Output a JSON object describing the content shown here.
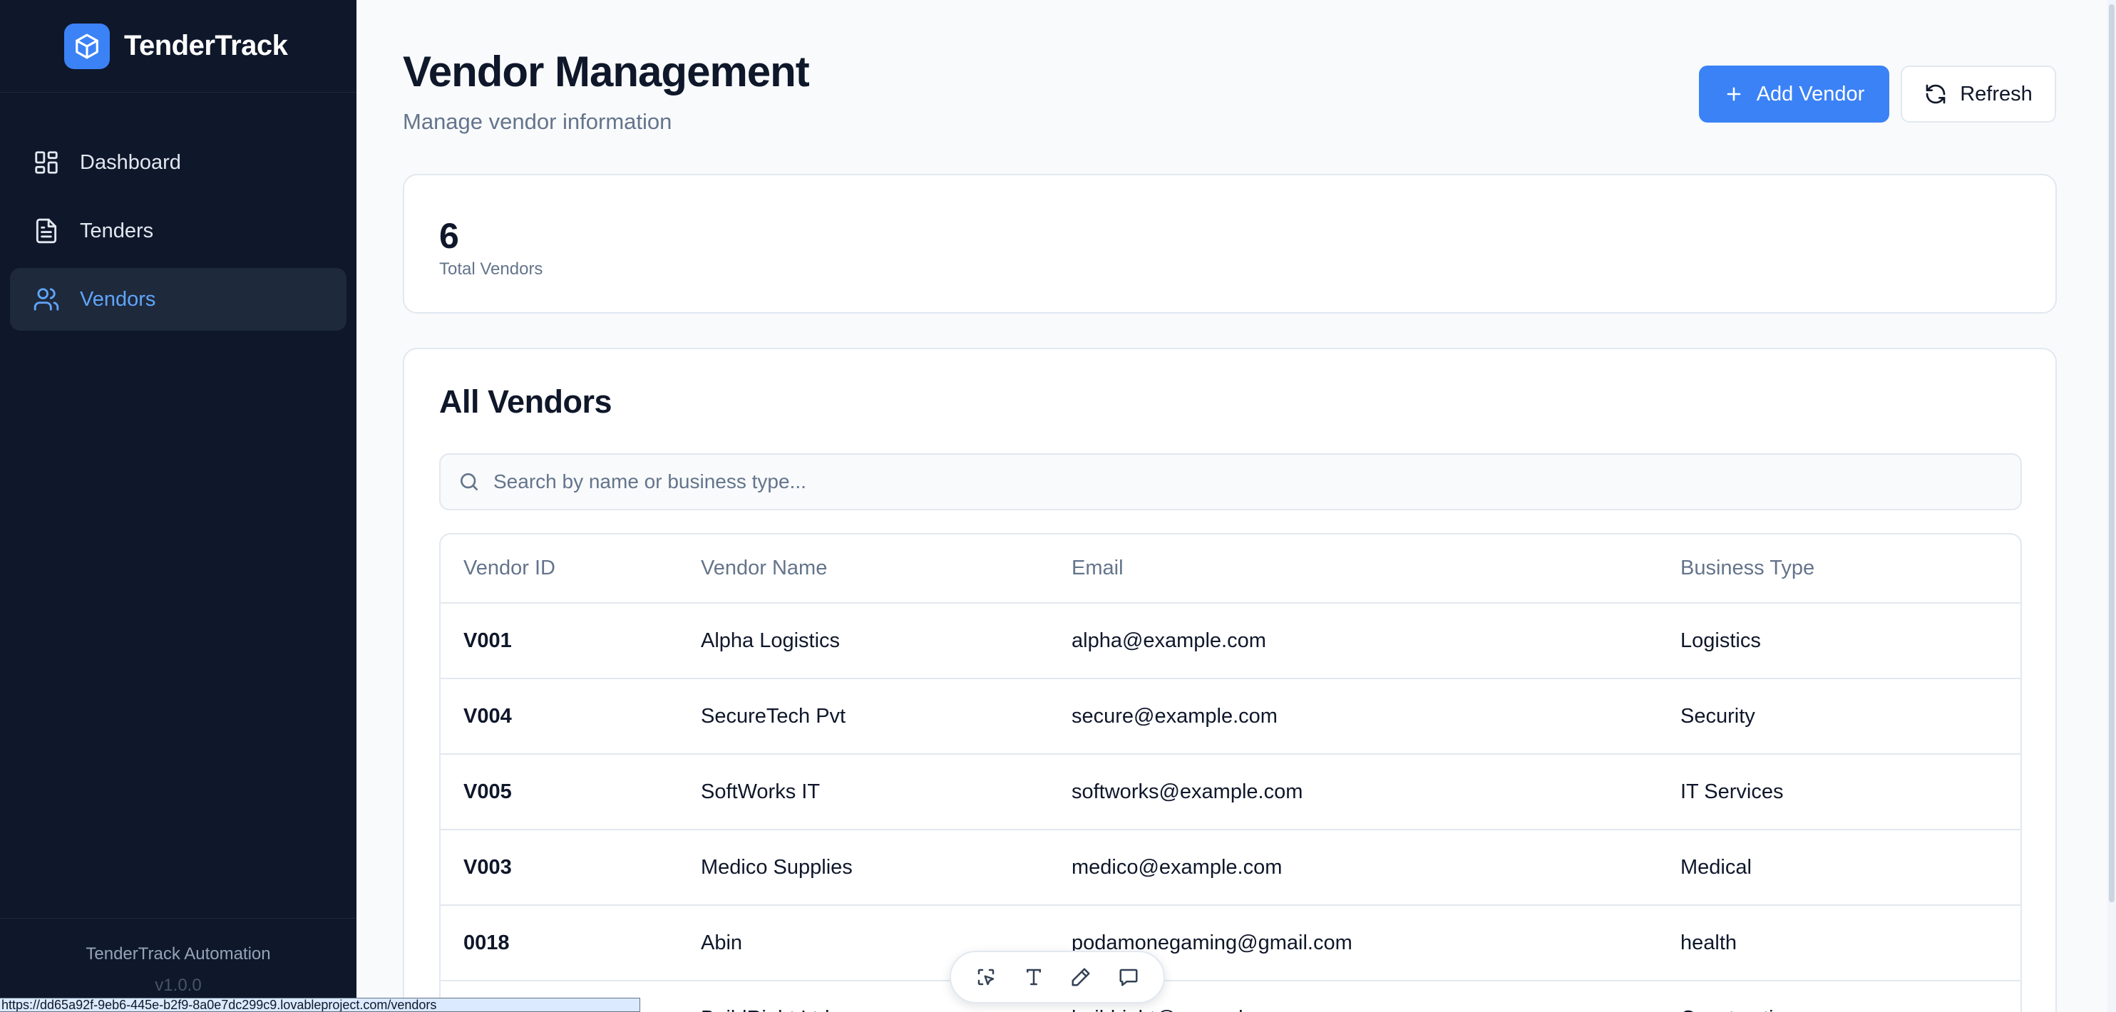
{
  "brand": {
    "name": "TenderTrack",
    "logo_icon": "cube-icon"
  },
  "sidebar": {
    "items": [
      {
        "label": "Dashboard",
        "icon": "dashboard-grid-icon",
        "active": false
      },
      {
        "label": "Tenders",
        "icon": "document-icon",
        "active": false
      },
      {
        "label": "Vendors",
        "icon": "users-icon",
        "active": true
      }
    ],
    "footer": {
      "app_name": "TenderTrack Automation",
      "version": "v1.0.0"
    }
  },
  "header": {
    "title": "Vendor Management",
    "subtitle": "Manage vendor information",
    "add_label": "Add Vendor",
    "refresh_label": "Refresh"
  },
  "stats": {
    "value": "6",
    "label": "Total Vendors"
  },
  "vendors": {
    "title": "All Vendors",
    "search_placeholder": "Search by name or business type...",
    "columns": [
      "Vendor ID",
      "Vendor Name",
      "Email",
      "Business Type"
    ],
    "rows": [
      [
        "V001",
        "Alpha Logistics",
        "alpha@example.com",
        "Logistics"
      ],
      [
        "V004",
        "SecureTech Pvt",
        "secure@example.com",
        "Security"
      ],
      [
        "V005",
        "SoftWorks IT",
        "softworks@example.com",
        "IT Services"
      ],
      [
        "V003",
        "Medico Supplies",
        "medico@example.com",
        "Medical"
      ],
      [
        "0018",
        "Abin",
        "podamonegaming@gmail.com",
        "health"
      ],
      [
        "",
        "BuildRight Ltd",
        "buildright@example.com",
        "Construction"
      ]
    ]
  },
  "toolbar": {
    "tools": [
      "select-icon",
      "text-icon",
      "pen-icon",
      "comment-icon"
    ]
  },
  "status_url": "https://dd65a92f-9eb6-445e-b2f9-8a0e7dc299c9.lovableproject.com/vendors",
  "colors": {
    "sidebar_bg": "#0f172a",
    "accent": "#3b82f6",
    "active_text": "#60a5fa"
  }
}
